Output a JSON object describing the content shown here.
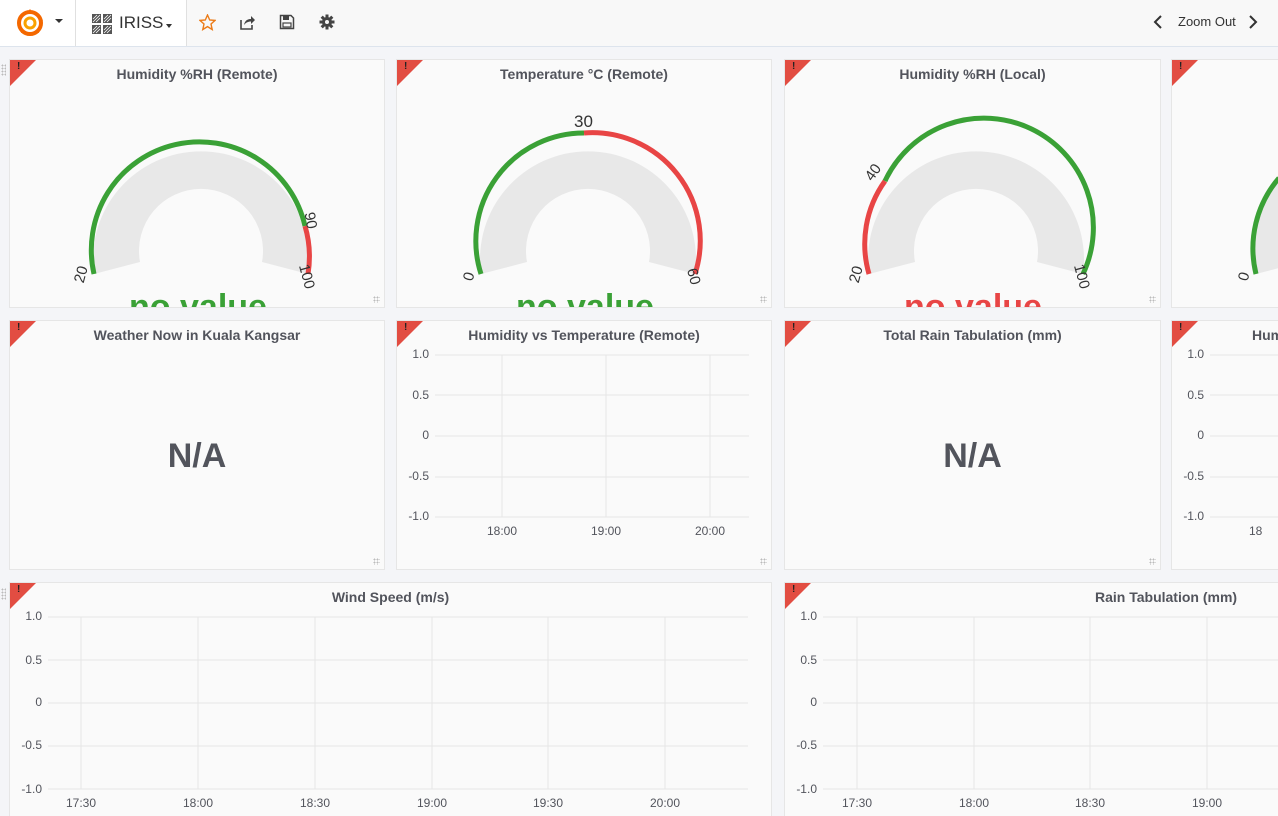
{
  "navbar": {
    "dashboard_title": "IRISS",
    "zoom_out_label": "Zoom Out",
    "icons": [
      "grafana-logo-icon",
      "dashboard-grid-icon",
      "star-icon",
      "share-icon",
      "save-icon",
      "settings-gear-icon",
      "chevron-left-icon",
      "chevron-right-icon"
    ],
    "colors": {
      "star": "#eb7b18",
      "logo": "#f46800"
    }
  },
  "panels": {
    "humidity_remote": {
      "title": "Humidity %RH (Remote)",
      "value": "no value",
      "value_color": "#3aa136",
      "ticks": [
        "20",
        "90",
        "100"
      ],
      "min": 20,
      "max": 100,
      "threshold": 90,
      "colors": {
        "ok": "#3aa136",
        "alert": "#e84545"
      }
    },
    "temperature_remote": {
      "title": "Temperature °C (Remote)",
      "value": "no value",
      "value_color": "#3aa136",
      "ticks": [
        "0",
        "30",
        "60"
      ],
      "min": 0,
      "max": 60,
      "threshold": 30,
      "colors": {
        "ok": "#3aa136",
        "alert": "#e84545"
      }
    },
    "humidity_local": {
      "title": "Humidity %RH (Local)",
      "value": "no value",
      "value_color": "#e84545",
      "ticks": [
        "20",
        "40",
        "100"
      ],
      "min": 20,
      "max": 100,
      "threshold": 40,
      "colors": {
        "ok": "#3aa136",
        "alert": "#e84545"
      }
    },
    "partial_gauge": {
      "ticks": [
        "0"
      ]
    },
    "weather_now": {
      "title": "Weather Now in Kuala Kangsar",
      "value": "N/A"
    },
    "humidity_vs_temperature": {
      "title": "Humidity vs Temperature (Remote)",
      "y_ticks": [
        "1.0",
        "0.5",
        "0",
        "-0.5",
        "-1.0"
      ],
      "x_ticks": [
        "18:00",
        "19:00",
        "20:00"
      ]
    },
    "total_rain": {
      "title": "Total Rain Tabulation (mm)",
      "value": "N/A"
    },
    "partial_graph": {
      "title": "Hum",
      "y_ticks": [
        "1.0",
        "0.5",
        "0",
        "-0.5",
        "-1.0"
      ],
      "x_ticks": [
        "18"
      ]
    },
    "wind_speed": {
      "title": "Wind Speed (m/s)",
      "y_ticks": [
        "1.0",
        "0.5",
        "0",
        "-0.5",
        "-1.0"
      ],
      "x_ticks": [
        "17:30",
        "18:00",
        "18:30",
        "19:00",
        "19:30",
        "20:00"
      ]
    },
    "rain_tabulation": {
      "title": "Rain Tabulation (mm)",
      "y_ticks": [
        "1.0",
        "0.5",
        "0",
        "-0.5",
        "-1.0"
      ],
      "x_ticks": [
        "17:30",
        "18:00",
        "18:30",
        "19:00"
      ]
    },
    "error_indicator": "!"
  }
}
